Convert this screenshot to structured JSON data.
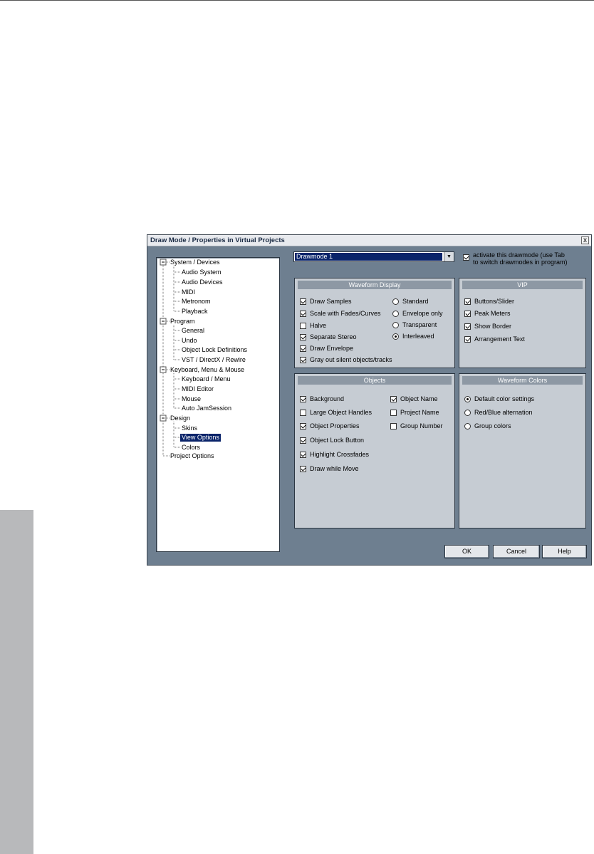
{
  "dialog": {
    "title": "Draw Mode / Properties in Virtual Projects",
    "close_label": "x"
  },
  "tree": {
    "items": [
      {
        "label": "System / Devices",
        "level": 0
      },
      {
        "label": "Audio System",
        "level": 1
      },
      {
        "label": "Audio Devices",
        "level": 1
      },
      {
        "label": "MIDI",
        "level": 1
      },
      {
        "label": "Metronom",
        "level": 1
      },
      {
        "label": "Playback",
        "level": 1
      },
      {
        "label": "Program",
        "level": 0
      },
      {
        "label": "General",
        "level": 1
      },
      {
        "label": "Undo",
        "level": 1
      },
      {
        "label": "Object Lock Definitions",
        "level": 1
      },
      {
        "label": "VST / DirectX / Rewire",
        "level": 1
      },
      {
        "label": "Keyboard, Menu & Mouse",
        "level": 0
      },
      {
        "label": "Keyboard / Menu",
        "level": 1
      },
      {
        "label": "MIDI Editor",
        "level": 1
      },
      {
        "label": "Mouse",
        "level": 1
      },
      {
        "label": "Auto JamSession",
        "level": 1
      },
      {
        "label": "Design",
        "level": 0
      },
      {
        "label": "Skins",
        "level": 1
      },
      {
        "label": "View Options",
        "level": 1,
        "selected": true
      },
      {
        "label": "Colors",
        "level": 1
      },
      {
        "label": "Project Options",
        "level": 0
      }
    ]
  },
  "drawmode": {
    "selected": "Drawmode 1",
    "activate_checked": true,
    "activate_label_1": "activate this drawmode (use Tab",
    "activate_label_2": "to switch drawmodes in program)"
  },
  "waveform_display": {
    "title": "Waveform Display",
    "checks": [
      {
        "label": "Draw Samples",
        "checked": true
      },
      {
        "label": "Scale with Fades/Curves",
        "checked": true
      },
      {
        "label": "Halve",
        "checked": false
      },
      {
        "label": "Separate Stereo",
        "checked": true
      },
      {
        "label": "Draw Envelope",
        "checked": true
      },
      {
        "label": "Gray out silent objects/tracks",
        "checked": true
      }
    ],
    "radios": [
      {
        "label": "Standard",
        "selected": false
      },
      {
        "label": "Envelope only",
        "selected": false
      },
      {
        "label": "Transparent",
        "selected": false
      },
      {
        "label": "Interleaved",
        "selected": true
      }
    ]
  },
  "vip": {
    "title": "VIP",
    "checks": [
      {
        "label": "Buttons/Slider",
        "checked": true
      },
      {
        "label": "Peak Meters",
        "checked": true
      },
      {
        "label": "Show Border",
        "checked": true
      },
      {
        "label": "Arrangement Text",
        "checked": true
      }
    ]
  },
  "objects": {
    "title": "Objects",
    "left": [
      {
        "label": "Background",
        "checked": true
      },
      {
        "label": "Large Object Handles",
        "checked": false
      },
      {
        "label": "Object Properties",
        "checked": true
      },
      {
        "label": "Object Lock Button",
        "checked": true
      },
      {
        "label": "Highlight Crossfades",
        "checked": true
      },
      {
        "label": "Draw while Move",
        "checked": true
      }
    ],
    "right": [
      {
        "label": "Object Name",
        "checked": true
      },
      {
        "label": "Project Name",
        "checked": false
      },
      {
        "label": "Group Number",
        "checked": false
      }
    ]
  },
  "waveform_colors": {
    "title": "Waveform Colors",
    "radios": [
      {
        "label": "Default color settings",
        "selected": true
      },
      {
        "label": "Red/Blue alternation",
        "selected": false
      },
      {
        "label": "Group colors",
        "selected": false
      }
    ]
  },
  "buttons": {
    "ok": "OK",
    "cancel": "Cancel",
    "help": "Help"
  }
}
